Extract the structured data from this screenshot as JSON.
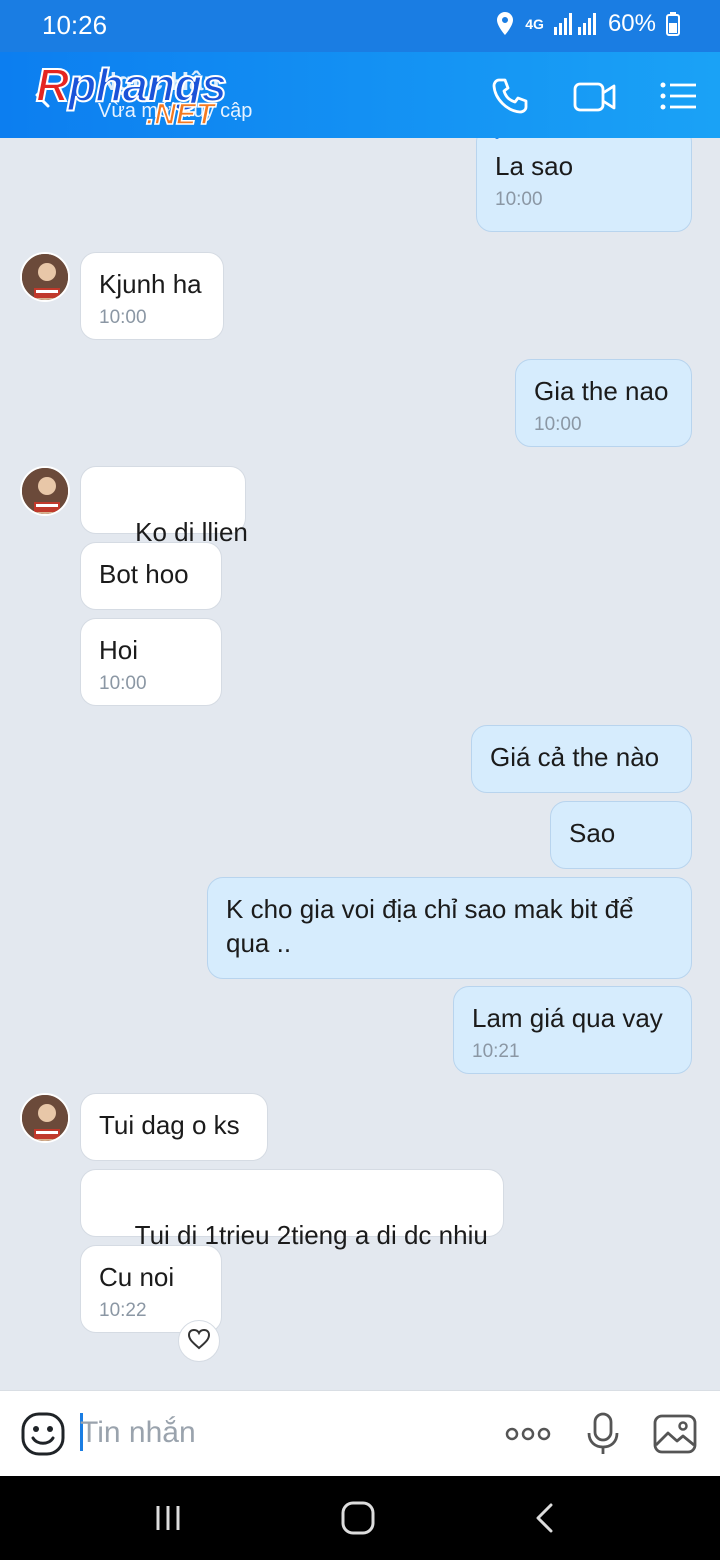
{
  "status_bar": {
    "time": "10:26",
    "network": "4G",
    "battery": "60%"
  },
  "header": {
    "chat_name": "Ngọc Hân",
    "status": "Vừa mới truy cập",
    "logo_main": "Rphang",
    "logo_main_first": "R",
    "logo_main_rest": "phangs",
    "logo_suffix": ".NET",
    "icons": [
      "back-icon",
      "phone-icon",
      "video-icon",
      "menu-icon"
    ]
  },
  "messages": [
    {
      "side": "out",
      "quote": "Toi moi vo ks",
      "text": "La sao",
      "time": "10:00"
    },
    {
      "side": "in",
      "text": "Kjunh ha",
      "time": "10:00"
    },
    {
      "side": "out",
      "text": "Gia the nao",
      "time": "10:00"
    },
    {
      "side": "in",
      "text": " Ko di llien"
    },
    {
      "side": "in",
      "text": "Bot hoo"
    },
    {
      "side": "in",
      "text": "Hoi",
      "time": "10:00"
    },
    {
      "side": "out",
      "text": "Giá cả the nào"
    },
    {
      "side": "out",
      "text": "Sao"
    },
    {
      "side": "out",
      "text": "K cho gia voi địa chỉ sao mak bit để qua .."
    },
    {
      "side": "out",
      "text": "Lam giá qua vay",
      "time": "10:21"
    },
    {
      "side": "in",
      "text": "Tui dag o ks"
    },
    {
      "side": "in",
      "text": " Tui di 1trieu 2tieng a di dc nhiu"
    },
    {
      "side": "in",
      "text": "Cu noi",
      "time": "10:22"
    }
  ],
  "input": {
    "placeholder": "Tin nhắn"
  },
  "colors": {
    "brand": "#1a7de3",
    "bubble_out": "#d6ecfd",
    "bubble_in": "#ffffff",
    "background": "#e3e8ef"
  }
}
